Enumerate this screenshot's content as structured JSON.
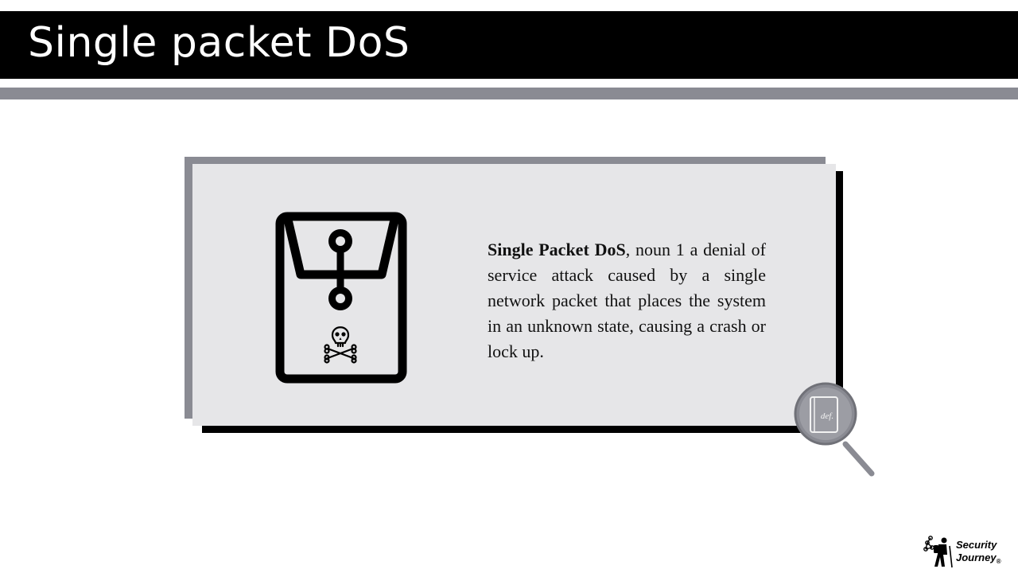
{
  "slide": {
    "title": "Single packet DoS"
  },
  "definition": {
    "term": "Single Packet DoS",
    "rest": ", noun  1 a denial of service attack caused by a single network packet that places the system in an unknown state, causing a crash or lock up."
  },
  "magnifier": {
    "label": "def."
  },
  "logo": {
    "line1": "Security",
    "line2": "Journey",
    "mark": "®"
  },
  "icons": {
    "envelope": "sealed-envelope-skull-icon",
    "magnifier": "magnifier-definition-icon",
    "logo": "security-journey-logo"
  },
  "colors": {
    "title_bar": "#000000",
    "accent_gray": "#8a8b93",
    "card_background": "#e6e6e8"
  }
}
